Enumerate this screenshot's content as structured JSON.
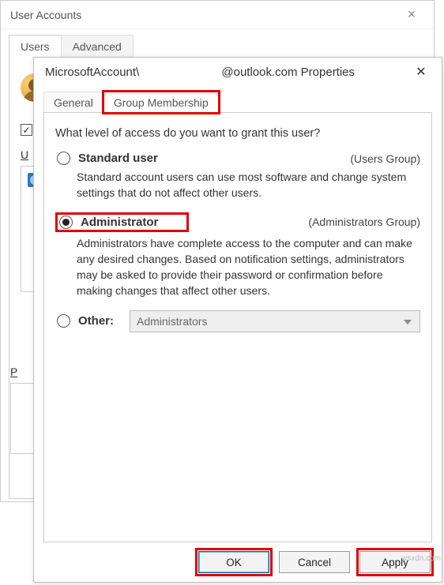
{
  "back": {
    "title": "User Accounts",
    "tabs": {
      "users": "Users",
      "advanced": "Advanced"
    },
    "usersHeading": "U"
  },
  "dialog": {
    "title": "MicrosoftAccount\\                         @outlook.com Properties",
    "tabs": {
      "general": "General",
      "membership": "Group Membership"
    },
    "intro": "What level of access do you want to grant this user?",
    "options": {
      "standard": {
        "label": "Standard user",
        "group": "(Users Group)",
        "desc": "Standard account users can use most software and change system settings that do not affect other users."
      },
      "admin": {
        "label": "Administrator",
        "group": "(Administrators Group)",
        "desc": "Administrators have complete access to the computer and can make any desired changes. Based on notification settings, administrators may be asked to provide their password or confirmation before making changes that affect other users."
      },
      "other": {
        "label": "Other:",
        "dropdown": "Administrators"
      }
    },
    "buttons": {
      "ok": "OK",
      "cancel": "Cancel",
      "apply": "Apply"
    }
  },
  "watermark": "wsxdn.com"
}
